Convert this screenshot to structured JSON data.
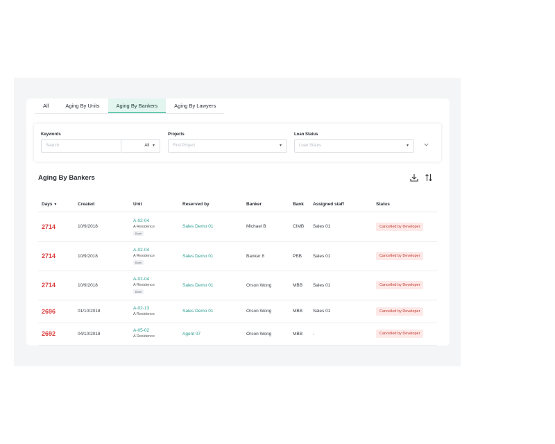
{
  "tabs": [
    {
      "label": "All"
    },
    {
      "label": "Aging By Units"
    },
    {
      "label": "Aging By Bankers",
      "active": true
    },
    {
      "label": "Aging By Lawyers"
    }
  ],
  "filters": {
    "keywords_label": "Keywords",
    "search_placeholder": "Search",
    "search_scope": "All",
    "projects_label": "Projects",
    "projects_placeholder": "Find Project",
    "loan_status_label": "Loan Status",
    "loan_status_placeholder": "Loan Status"
  },
  "section_title": "Aging By Bankers",
  "table": {
    "headers": {
      "days": "Days",
      "created": "Created",
      "unit": "Unit",
      "reserved_by": "Reserved by",
      "banker": "Banker",
      "bank": "Bank",
      "assigned_staff": "Assigned staff",
      "status": "Status"
    },
    "rows": [
      {
        "days": "2714",
        "created": "10/9/2018",
        "unit_code": "A-02-04",
        "unit_project": "A Residence",
        "unit_tag": "Bumi",
        "reserved_by": "Sales Demo 01",
        "banker": "Michael B",
        "bank": "CIMB",
        "staff": "Sales 01",
        "status": "Cancelled by Developer"
      },
      {
        "days": "2714",
        "created": "10/9/2018",
        "unit_code": "A-02-04",
        "unit_project": "A Residence",
        "unit_tag": "Bumi",
        "reserved_by": "Sales Demo 01",
        "banker": "Banker 8",
        "bank": "PBB",
        "staff": "Sales 01",
        "status": "Cancelled by Developer"
      },
      {
        "days": "2714",
        "created": "10/9/2018",
        "unit_code": "A-02-04",
        "unit_project": "A Residence",
        "unit_tag": "Bumi",
        "reserved_by": "Sales Demo 01",
        "banker": "Orson Wong",
        "bank": "MBB",
        "staff": "Sales 01",
        "status": "Cancelled by Developer"
      },
      {
        "days": "2696",
        "created": "01/10/2018",
        "unit_code": "A-02-13",
        "unit_project": "A Residence",
        "unit_tag": "",
        "reserved_by": "Sales Demo 01",
        "banker": "Orson Wong",
        "bank": "MBB",
        "staff": "Sales 01",
        "status": "Cancelled by Developer"
      },
      {
        "days": "2692",
        "created": "04/10/2018",
        "unit_code": "A-05-02",
        "unit_project": "A Residence",
        "unit_tag": "",
        "reserved_by": "Agent 07",
        "banker": "Orson Wong",
        "bank": "MBB",
        "staff": "-",
        "status": "Cancelled by Developer"
      }
    ]
  },
  "icons": {
    "download": "download-icon",
    "sort": "sort-icon",
    "caret": "caret-down-icon",
    "expand": "chevron-down-icon"
  },
  "colors": {
    "accent": "#2a9d8f",
    "days_red": "#d93b3b",
    "badge_bg": "#fde9e8",
    "badge_text": "#c0392b",
    "active_tab_bg": "#e3f5ef"
  }
}
